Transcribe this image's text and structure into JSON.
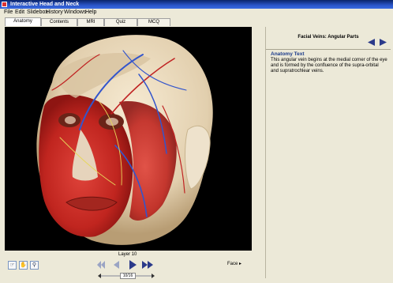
{
  "app": {
    "title": "Interactive Head and Neck"
  },
  "menu": {
    "items": [
      "File",
      "Edit",
      "Slidebox",
      "History",
      "Windows",
      "Help"
    ]
  },
  "tabs": [
    "Anatomy",
    "Contents",
    "MRI",
    "Quiz",
    "MCQ"
  ],
  "viewer": {
    "layer_label": "Layer 10",
    "face_label": "Face ▸",
    "page": "10/16"
  },
  "panel": {
    "title": "Facial Veins: Angular Parts",
    "subtitle": "Anatomy Text",
    "body": "This angular vein begins at the medial corner of the eye and is formed by the confluence of the supra-orbital and supratrochlear veins."
  },
  "icons": [
    "rotate-hand-icon",
    "pan-hand-icon",
    "zoom-icon",
    "first-icon",
    "prev-icon",
    "play-icon",
    "next-icon",
    "prev-arrow-icon",
    "next-arrow-icon"
  ],
  "colors": {
    "title_bar": "#0a246a",
    "panel_bg": "#ece9d8",
    "nav_arrow": "#2b3a8a",
    "subtitle_text": "#1a3a8a"
  }
}
